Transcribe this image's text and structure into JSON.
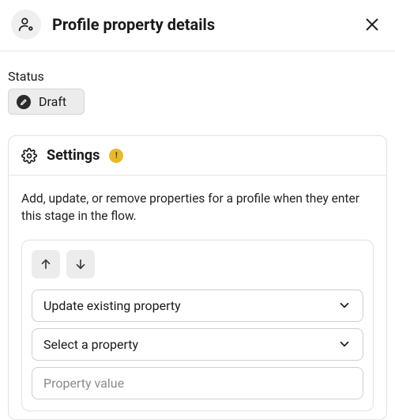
{
  "header": {
    "title": "Profile property details"
  },
  "status": {
    "label": "Status",
    "value": "Draft"
  },
  "settings": {
    "title": "Settings",
    "warning_glyph": "!",
    "description": "Add, update, or remove properties for a profile when they enter this stage in the flow.",
    "property": {
      "action_selected": "Update existing property",
      "property_selected": "Select a property",
      "value_placeholder": "Property value"
    }
  }
}
